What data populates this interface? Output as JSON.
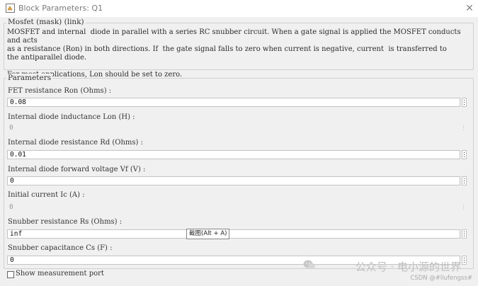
{
  "window": {
    "title": "Block Parameters: Q1",
    "close_icon": "close-icon"
  },
  "mask": {
    "header": "Mosfet (mask) (link)",
    "description": "MOSFET and internal  diode in parallel with a series RC snubber circuit. When a gate signal is applied the MOSFET conducts and acts\nas a resistance (Ron) in both directions. If  the gate signal falls to zero when current is negative, current  is transferred to\nthe antiparallel diode.\n\nFor most applications, Lon should be set to zero."
  },
  "parameters": {
    "header": "Parameters",
    "items": [
      {
        "label": "FET resistance Ron (Ohms) :",
        "value": "0.08",
        "enabled": true
      },
      {
        "label": "Internal diode inductance Lon (H) :",
        "value": "0",
        "enabled": false
      },
      {
        "label": "Internal diode resistance Rd  (Ohms) :",
        "value": "0.01",
        "enabled": true
      },
      {
        "label": "Internal diode forward voltage Vf (V) :",
        "value": "0",
        "enabled": true
      },
      {
        "label": "Initial current Ic (A) :",
        "value": "0",
        "enabled": false
      },
      {
        "label": "Snubber resistance Rs (Ohms) :",
        "value": "inf",
        "enabled": true
      },
      {
        "label": "Snubber capacitance Cs (F) :",
        "value": "0",
        "enabled": true
      }
    ]
  },
  "tooltip": "截图(Alt + A)",
  "checkbox": {
    "label": "Show measurement port",
    "checked": false
  },
  "watermark": {
    "text": "公众号 · 电小源的世界",
    "source": "CSDN @#liufengss#"
  }
}
